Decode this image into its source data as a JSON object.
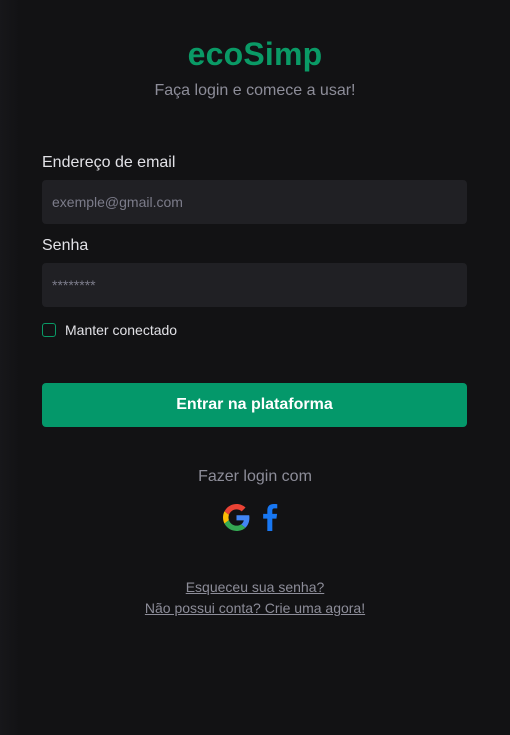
{
  "brand": {
    "name": "ecoSimp",
    "subtitle": "Faça login e comece a usar!"
  },
  "form": {
    "email_label": "Endereço de email",
    "email_placeholder": "exemple@gmail.com",
    "password_label": "Senha",
    "password_placeholder": "********",
    "remember_label": "Manter conectado",
    "remember_checked": false,
    "submit_label": "Entrar na plataforma"
  },
  "social": {
    "title": "Fazer login com",
    "providers": [
      {
        "name": "Google",
        "icon": "google-icon"
      },
      {
        "name": "Facebook",
        "icon": "facebook-icon"
      }
    ]
  },
  "links": {
    "forgot": "Esqueceu sua senha?",
    "signup": "Não possui conta? Crie uma agora!"
  },
  "colors": {
    "background": "#121214",
    "accent": "#04986a",
    "input_bg": "#202024",
    "muted_text": "#8d8d99"
  }
}
